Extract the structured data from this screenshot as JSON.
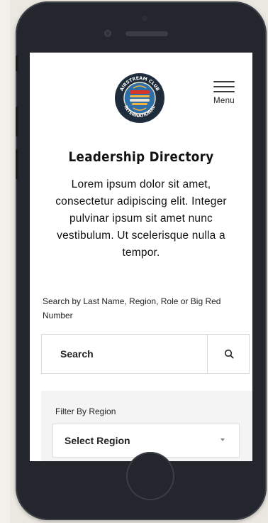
{
  "header": {
    "logo_text": "AIRSTREAM CLUB INTERNATIONAL",
    "menu_label": "Menu"
  },
  "page": {
    "title": "Leadership Directory",
    "intro": "Lorem ipsum dolor sit amet, consectetur adipiscing elit. Integer pulvinar ipsum sit amet nunc vestibulum. Ut scelerisque nulla a tempor."
  },
  "search": {
    "help_text": "Search by Last Name, Region, Role or Big Red Number",
    "placeholder": "Search"
  },
  "filter": {
    "label": "Filter By Region",
    "select_value": "Select Region"
  },
  "colors": {
    "screen_bg": "#ffffff",
    "panel_bg": "#f4f4f4",
    "phone_body": "#23262c"
  }
}
